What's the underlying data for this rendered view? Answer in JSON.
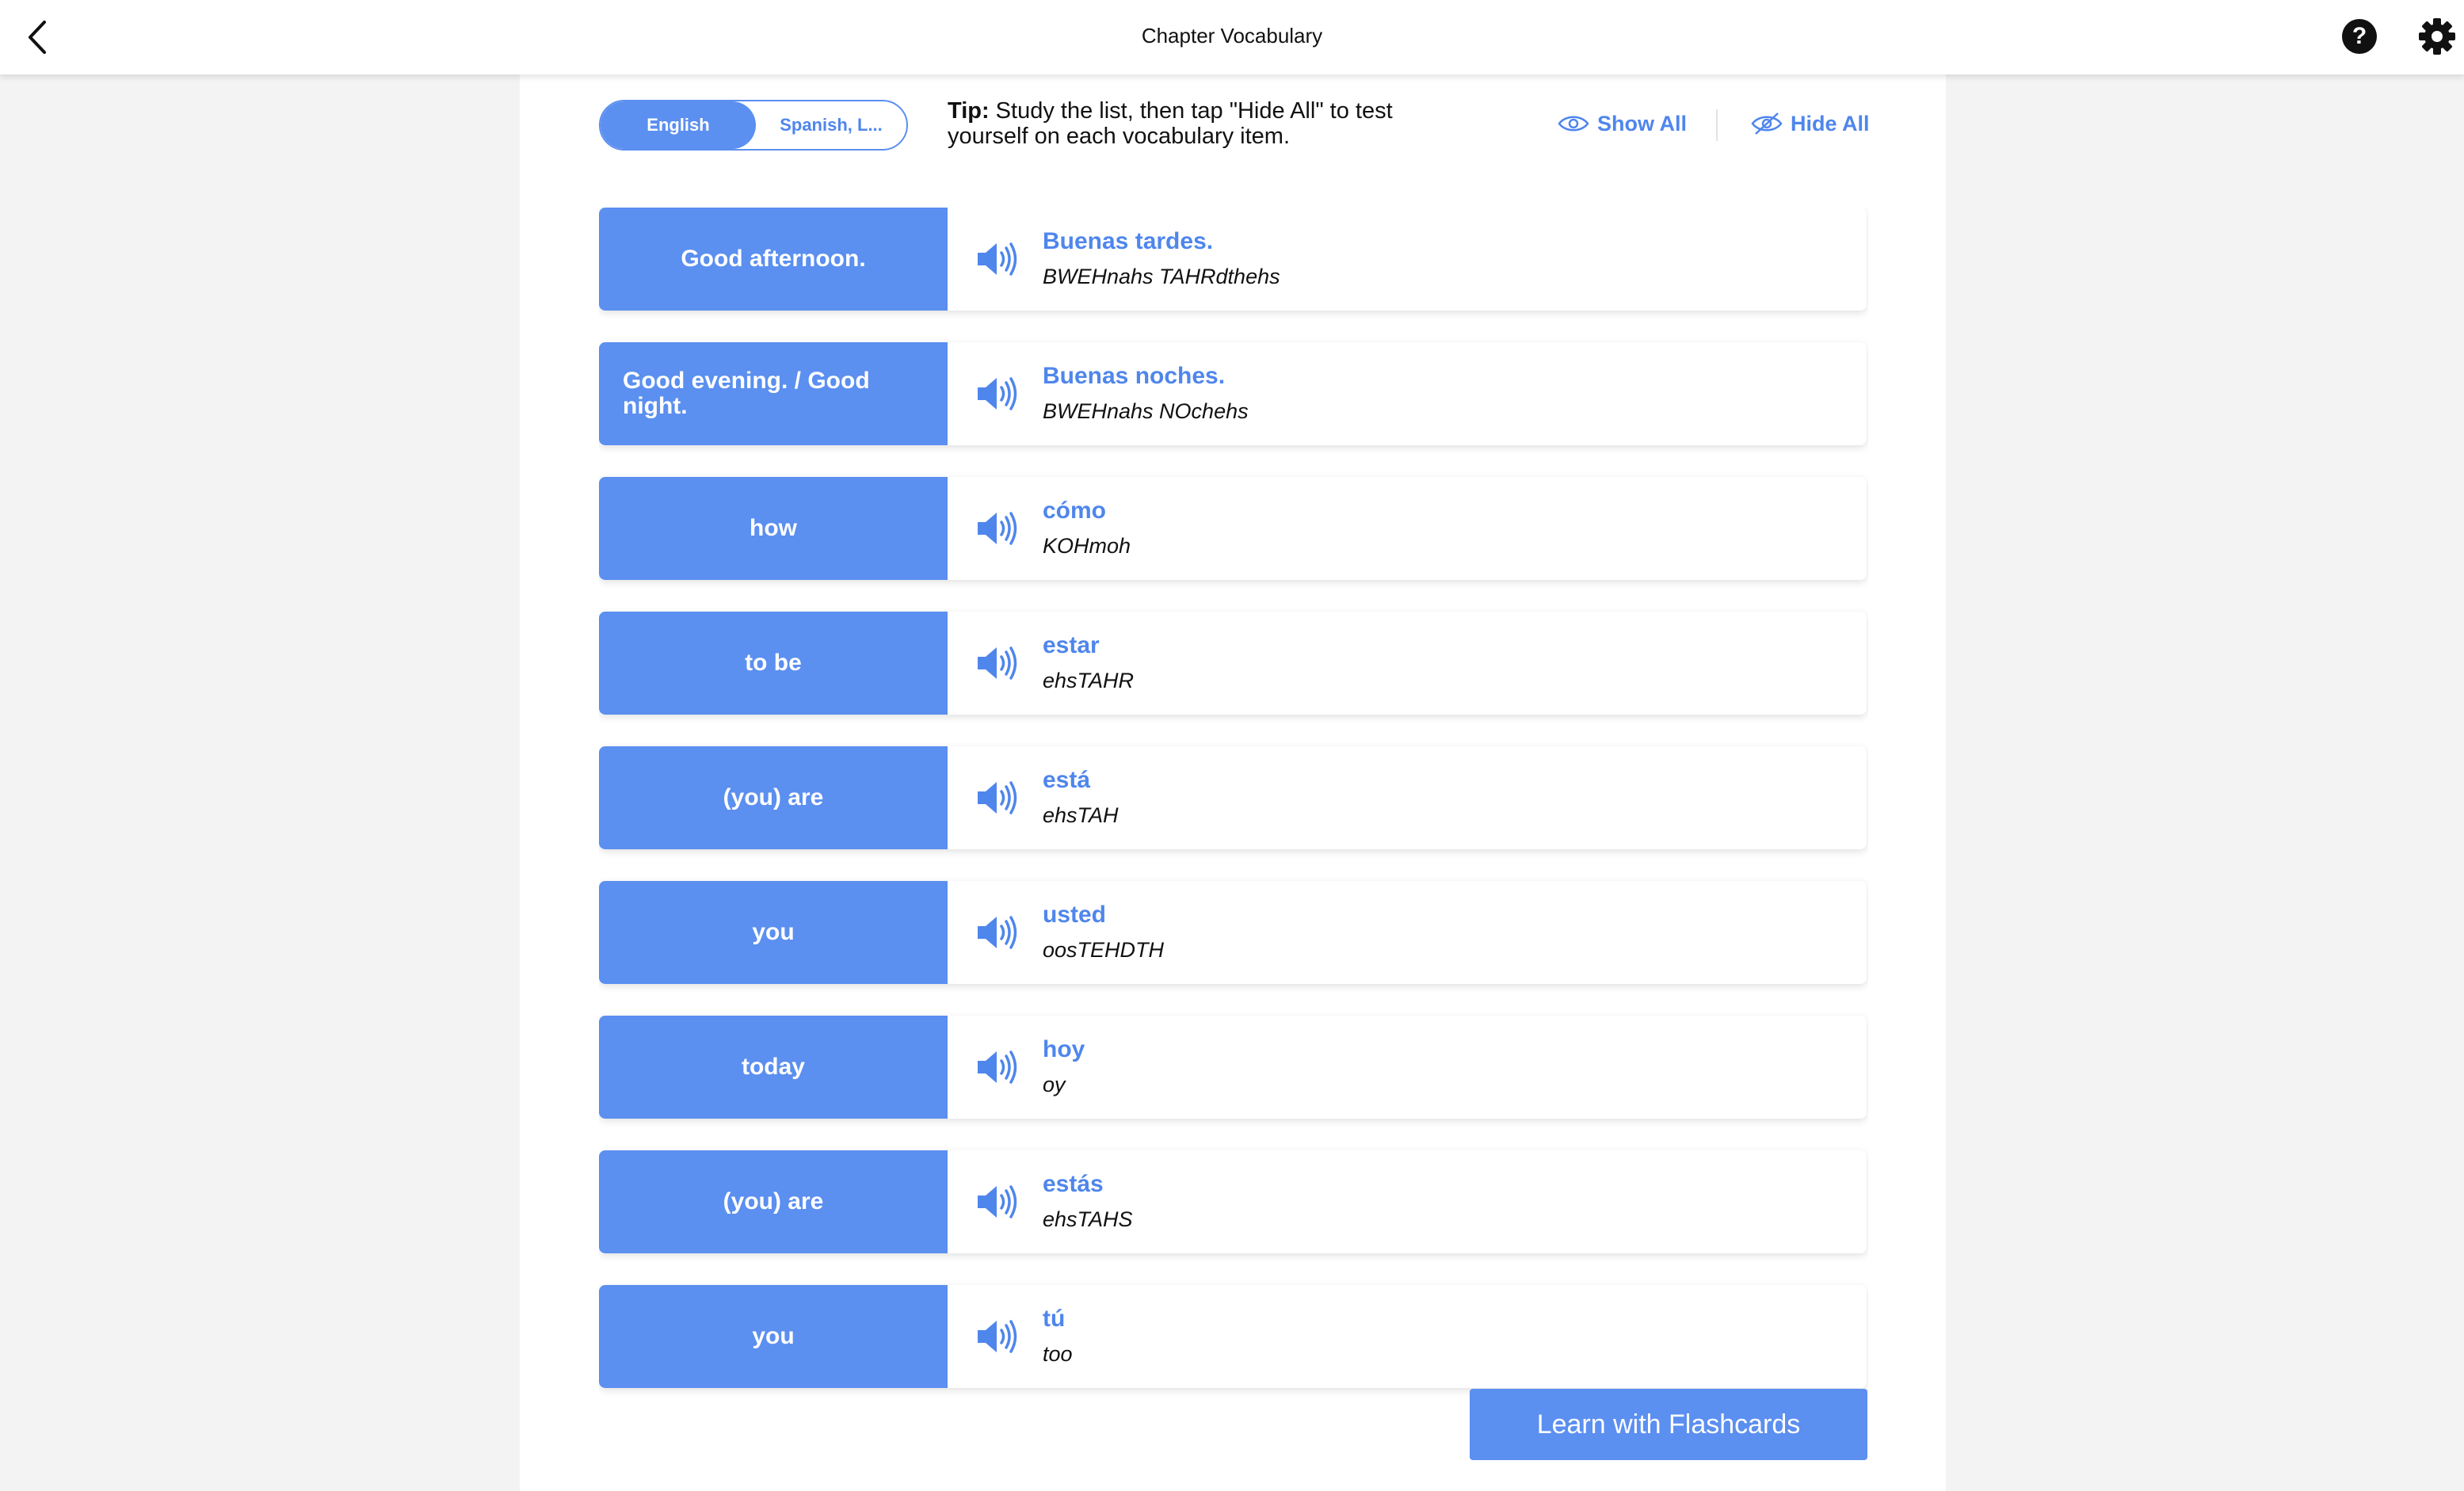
{
  "header": {
    "title": "Chapter Vocabulary"
  },
  "toggle": {
    "options": [
      "English",
      "Spanish, L..."
    ],
    "selected": "English"
  },
  "tip": {
    "label": "Tip:",
    "text": " Study the list, then tap \"Hide All\" to test yourself on each vocabulary item."
  },
  "controls": {
    "show_all": "Show All",
    "hide_all": "Hide All"
  },
  "vocab": [
    {
      "english": "Good afternoon.",
      "spanish": "Buenas tardes.",
      "pronunciation": "BWEHnahs TAHRdthehs"
    },
    {
      "english": "Good evening. / Good night.",
      "spanish": "Buenas noches.",
      "pronunciation": "BWEHnahs NOchehs"
    },
    {
      "english": "how",
      "spanish": "cómo",
      "pronunciation": "KOHmoh"
    },
    {
      "english": "to be",
      "spanish": "estar",
      "pronunciation": "ehsTAHR"
    },
    {
      "english": "(you) are",
      "spanish": "está",
      "pronunciation": "ehsTAH"
    },
    {
      "english": "you",
      "spanish": "usted",
      "pronunciation": "oosTEHDTH"
    },
    {
      "english": "today",
      "spanish": "hoy",
      "pronunciation": "oy"
    },
    {
      "english": "(you) are",
      "spanish": "estás",
      "pronunciation": "ehsTAHS"
    },
    {
      "english": "you",
      "spanish": "tú",
      "pronunciation": "too"
    }
  ],
  "footer": {
    "flashcards_label": "Learn with Flashcards"
  },
  "colors": {
    "accent": "#5b8ff0",
    "link": "#4f86ec",
    "page_bg": "#f3f3f3"
  },
  "icons": {
    "back": "chevron-left-icon",
    "help": "question-circle-icon",
    "settings": "gear-icon",
    "show": "eye-icon",
    "hide": "eye-slash-icon",
    "audio": "speaker-icon"
  }
}
